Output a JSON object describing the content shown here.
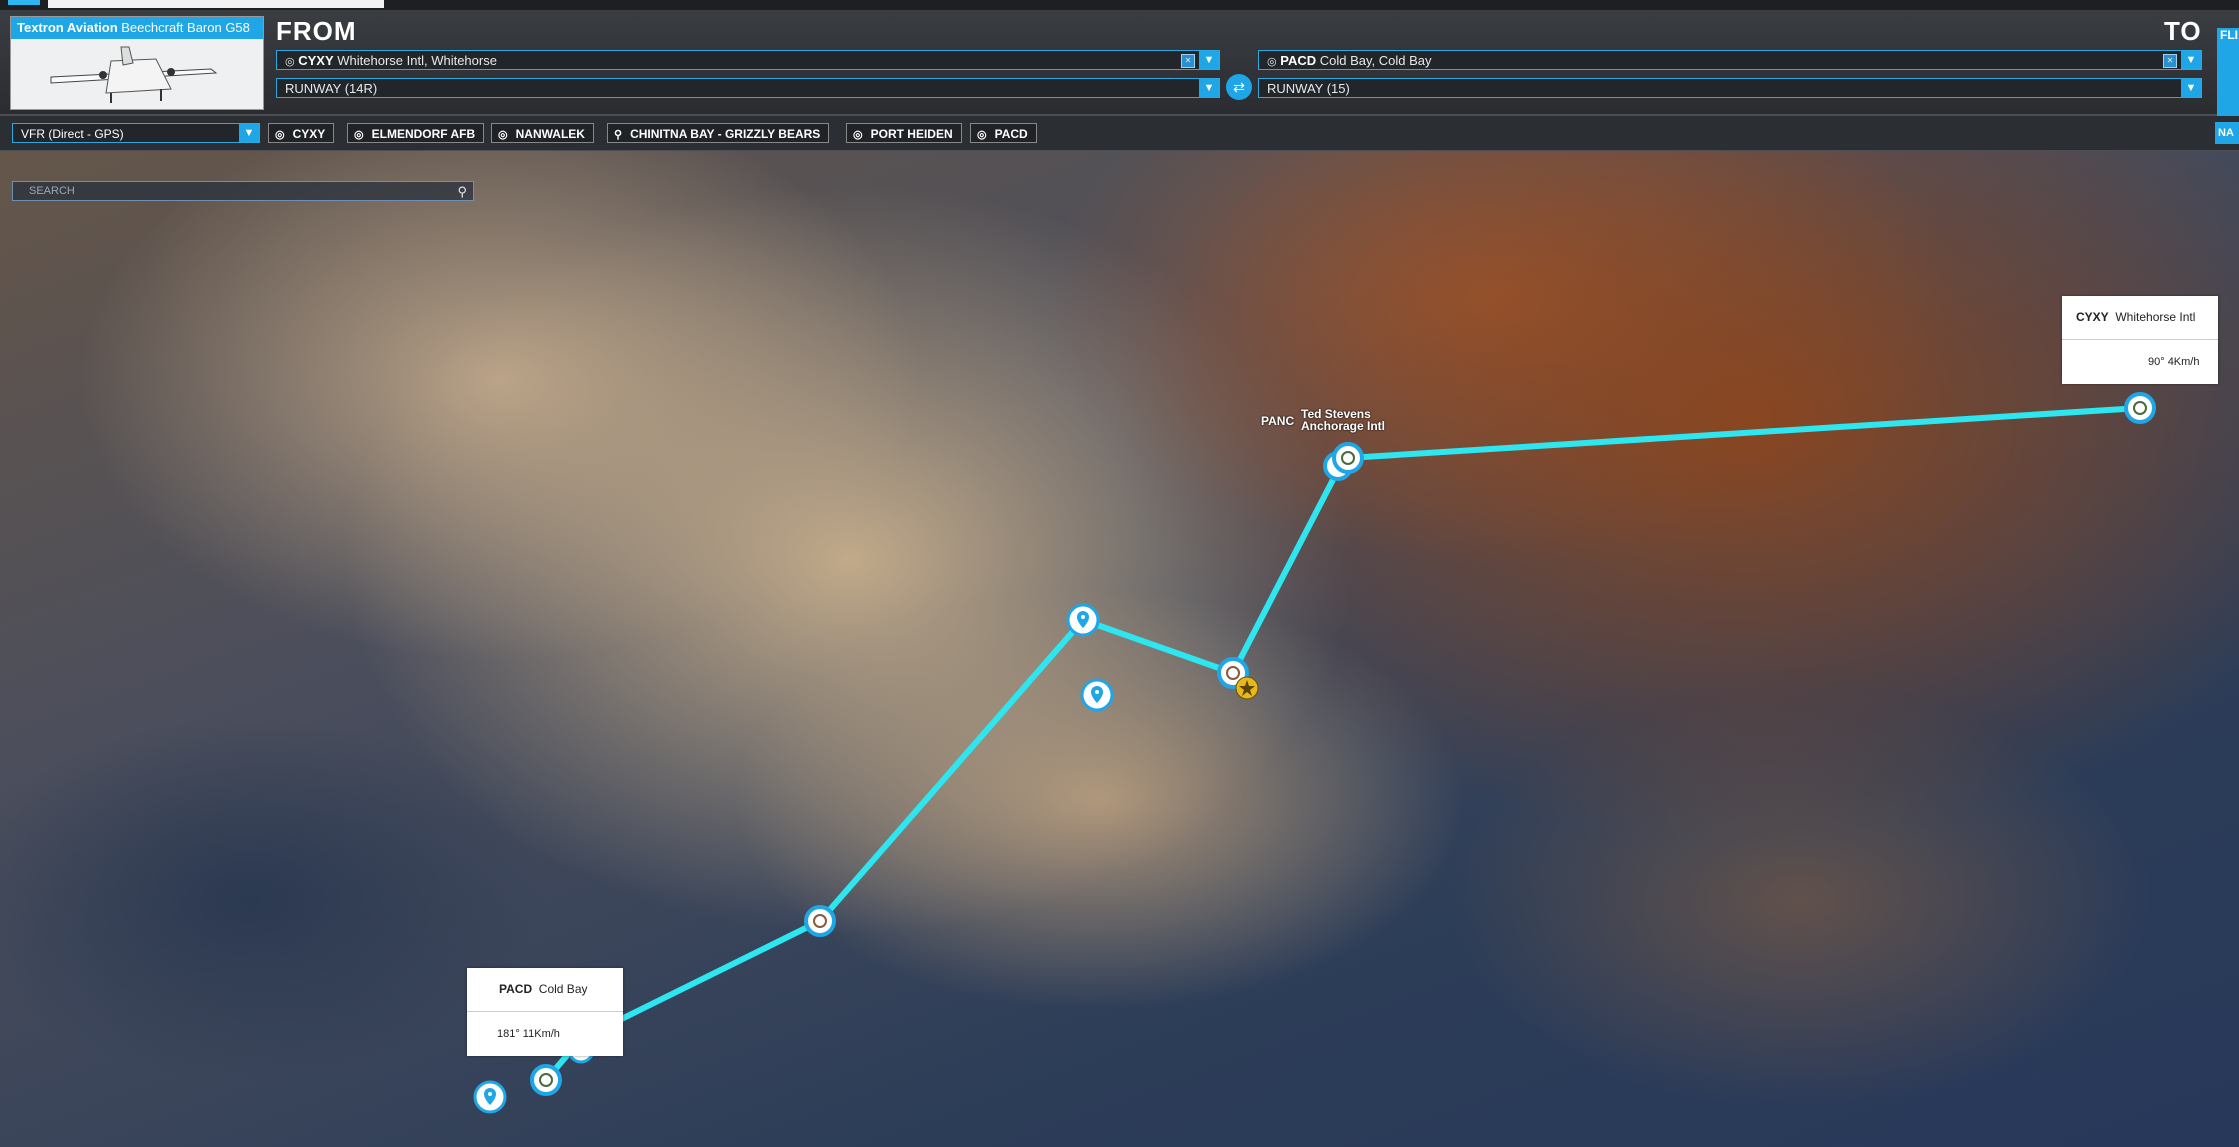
{
  "aircraft": {
    "brand": "Textron Aviation",
    "model": "Beechcraft Baron G58"
  },
  "from": {
    "label": "FROM",
    "airport_code": "CYXY",
    "airport_name": "Whitehorse Intl, Whitehorse",
    "runway": "RUNWAY (14R)"
  },
  "to": {
    "label": "TO",
    "airport_code": "PACD",
    "airport_name": "Cold Bay, Cold Bay",
    "runway": "RUNWAY (15)"
  },
  "flight_plan": {
    "type": "VFR (Direct - GPS)"
  },
  "waypoints": [
    "CYXY",
    "ELMENDORF AFB",
    "NANWALEK",
    "CHINITNA BAY - GRIZZLY BEARS",
    "PORT HEIDEN",
    "PACD"
  ],
  "side_tabs": {
    "flight": "FLI",
    "nav": "NA"
  },
  "search": {
    "placeholder": "SEARCH"
  },
  "map": {
    "panc_code": "PANC",
    "panc_name_line1": "Ted Stevens",
    "panc_name_line2": "Anchorage Intl",
    "tooltip_cyxy": {
      "code": "CYXY",
      "name": "Whitehorse Intl",
      "wind": "90° 4Km/h"
    },
    "tooltip_pacd": {
      "code": "PACD",
      "name": "Cold Bay",
      "wind": "181° 11Km/h"
    },
    "route_color": "#2ee6f0",
    "pin_color": "#1ea6e6"
  }
}
